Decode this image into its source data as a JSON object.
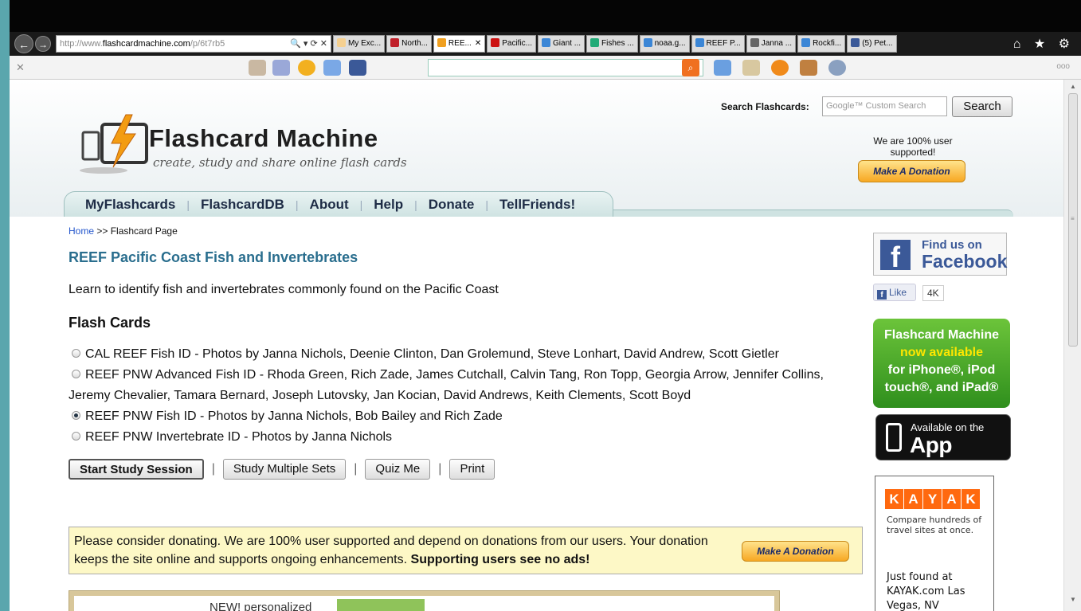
{
  "browser": {
    "url_prefix": "http://www.",
    "url_domain": "flashcardmachine.com",
    "url_path": "/p/6t7rb5",
    "url_controls": "🔍 ▾ ⟳ ✕",
    "tabs": [
      {
        "label": "My Exc...",
        "color": "#f5d090"
      },
      {
        "label": "North...",
        "color": "#c0202a"
      },
      {
        "label": "REE...",
        "color": "#f0a020",
        "active": true
      },
      {
        "label": "Pacific...",
        "color": "#cc1111"
      },
      {
        "label": "Giant ...",
        "color": "#3b86d6"
      },
      {
        "label": "Fishes ...",
        "color": "#2a7"
      },
      {
        "label": "noaa.g...",
        "color": "#3b86d6"
      },
      {
        "label": "REEF P...",
        "color": "#3b86d6"
      },
      {
        "label": "Janna ...",
        "color": "#666"
      },
      {
        "label": "Rockfi...",
        "color": "#3b86d6"
      },
      {
        "label": "(5) Pet...",
        "color": "#3b5998"
      }
    ],
    "tab_close": "✕",
    "icons": "⌂ ★ ⚙",
    "toolbar_close": "✕",
    "toolbar_more": "ooo",
    "toolbar_search_glyph": "⌕"
  },
  "header": {
    "search_label": "Search Flashcards:",
    "search_placeholder": "Google™ Custom Search",
    "search_button": "Search",
    "logo_title": "Flashcard Machine",
    "logo_tagline": "create, study and share online flash cards",
    "support_text": "We are 100% user supported!",
    "donate_button": "Make A Donation"
  },
  "nav": {
    "items": [
      "MyFlashcards",
      "FlashcardDB",
      "About",
      "Help",
      "Donate",
      "TellFriends!"
    ],
    "separator": "|"
  },
  "main": {
    "breadcrumb_home": "Home",
    "breadcrumb_rest": " >> Flashcard Page",
    "title": "REEF Pacific Coast Fish and Invertebrates",
    "description": "Learn to identify fish and invertebrates commonly found on the Pacific Coast",
    "section_heading": "Flash Cards",
    "sets": [
      {
        "label": "CAL REEF Fish ID - Photos by Janna Nichols, Deenie Clinton, Dan Grolemund, Steve Lonhart, David Andrew, Scott Gietler",
        "selected": false
      },
      {
        "label": "REEF PNW Advanced Fish ID - Rhoda Green, Rich Zade, James Cutchall, Calvin Tang, Ron Topp, Georgia Arrow, Jennifer Collins, Jeremy Chevalier, Tamara Bernard, Joseph Lutovsky, Jan Kocian, David Andrews, Keith Clements, Scott Boyd",
        "selected": false
      },
      {
        "label": "REEF PNW Fish ID - Photos by Janna Nichols, Bob Bailey and Rich Zade",
        "selected": true
      },
      {
        "label": "REEF PNW Invertebrate ID - Photos by Janna Nichols",
        "selected": false
      }
    ],
    "actions": {
      "start": "Start Study Session",
      "multiple": "Study Multiple Sets",
      "quiz": "Quiz Me",
      "print": "Print",
      "separator": "|"
    },
    "donation_text": "Please consider donating. We are 100% user supported and depend on donations from our users. Your donation keeps the site online and supports ongoing enhancements.",
    "donation_strong": "Supporting users see no ads!",
    "donation_button": "Make A Donation",
    "ad_text": "NEW! personalized"
  },
  "sidebar": {
    "fb_letter": "f",
    "fb_find": "Find us on",
    "fb_name": "Facebook",
    "like_label": "Like",
    "like_count": "4K",
    "promo_line1": "Flashcard Machine",
    "promo_line2": "now available",
    "promo_line3": "for iPhone®, iPod",
    "promo_line4": "touch®, and iPad®",
    "appstore_small": "Available on the",
    "appstore_big": "App Store",
    "kayak_letters": [
      "K",
      "A",
      "Y",
      "A",
      "K"
    ],
    "kayak_tag": "Compare hundreds of travel sites at once.",
    "kayak_found": "Just found at KAYAK.com Las Vegas, NV"
  },
  "colors": {
    "accent_title": "#2a6e8e",
    "donate_orange": "#f7a823",
    "facebook": "#3b5998",
    "promo_green": "#4cae2a",
    "kayak": "#ff690f"
  }
}
